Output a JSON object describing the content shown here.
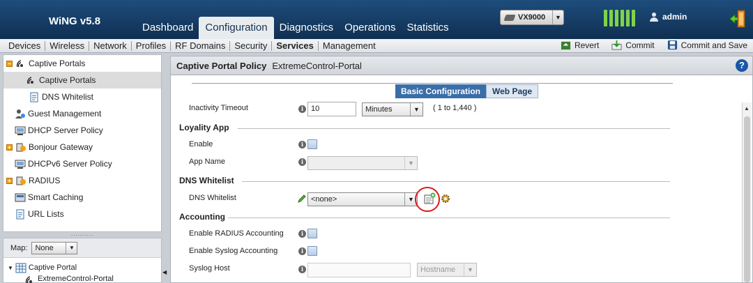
{
  "header": {
    "app_title": "WiNG v5.8",
    "main_tabs": [
      {
        "label": "Dashboard"
      },
      {
        "label": "Configuration"
      },
      {
        "label": "Diagnostics"
      },
      {
        "label": "Operations"
      },
      {
        "label": "Statistics"
      }
    ],
    "device_select": "VX9000",
    "user": "admin",
    "colors": {
      "header": "#16395f",
      "signal": "#7fd24a"
    }
  },
  "subnav": {
    "items": [
      {
        "label": "Devices"
      },
      {
        "label": "Wireless"
      },
      {
        "label": "Network"
      },
      {
        "label": "Profiles"
      },
      {
        "label": "RF Domains"
      },
      {
        "label": "Security"
      },
      {
        "label": "Services"
      },
      {
        "label": "Management"
      }
    ],
    "actions": {
      "revert": "Revert",
      "commit": "Commit",
      "commit_save": "Commit and Save"
    }
  },
  "tree": {
    "items": [
      {
        "label": "Captive Portals"
      },
      {
        "label": "Captive Portals"
      },
      {
        "label": "DNS Whitelist"
      },
      {
        "label": "Guest Management"
      },
      {
        "label": "DHCP Server Policy"
      },
      {
        "label": "Bonjour Gateway"
      },
      {
        "label": "DHCPv6 Server Policy"
      },
      {
        "label": "RADIUS"
      },
      {
        "label": "Smart Caching"
      },
      {
        "label": "URL Lists"
      }
    ],
    "map_label": "Map:",
    "map_value": "None",
    "lower_items": [
      {
        "label": "Captive Portal"
      },
      {
        "label": "ExtremeControl-Portal"
      }
    ]
  },
  "panel": {
    "title": "Captive Portal Policy",
    "policy_name": "ExtremeControl-Portal",
    "help": "?",
    "tabs": {
      "basic": "Basic Configuration",
      "web": "Web Page"
    },
    "inactivity": {
      "label": "Inactivity Timeout",
      "value": "10",
      "unit": "Minutes",
      "range": "( 1 to 1,440 )"
    },
    "loyality": {
      "section": "Loyality App",
      "enable": "Enable",
      "app_name": "App Name"
    },
    "dns": {
      "section": "DNS Whitelist",
      "label": "DNS Whitelist",
      "value": "<none>"
    },
    "accounting": {
      "section": "Accounting",
      "radius": "Enable RADIUS Accounting",
      "syslog": "Enable Syslog Accounting",
      "syslog_host": "Syslog Host",
      "host_type": "Hostname"
    }
  }
}
